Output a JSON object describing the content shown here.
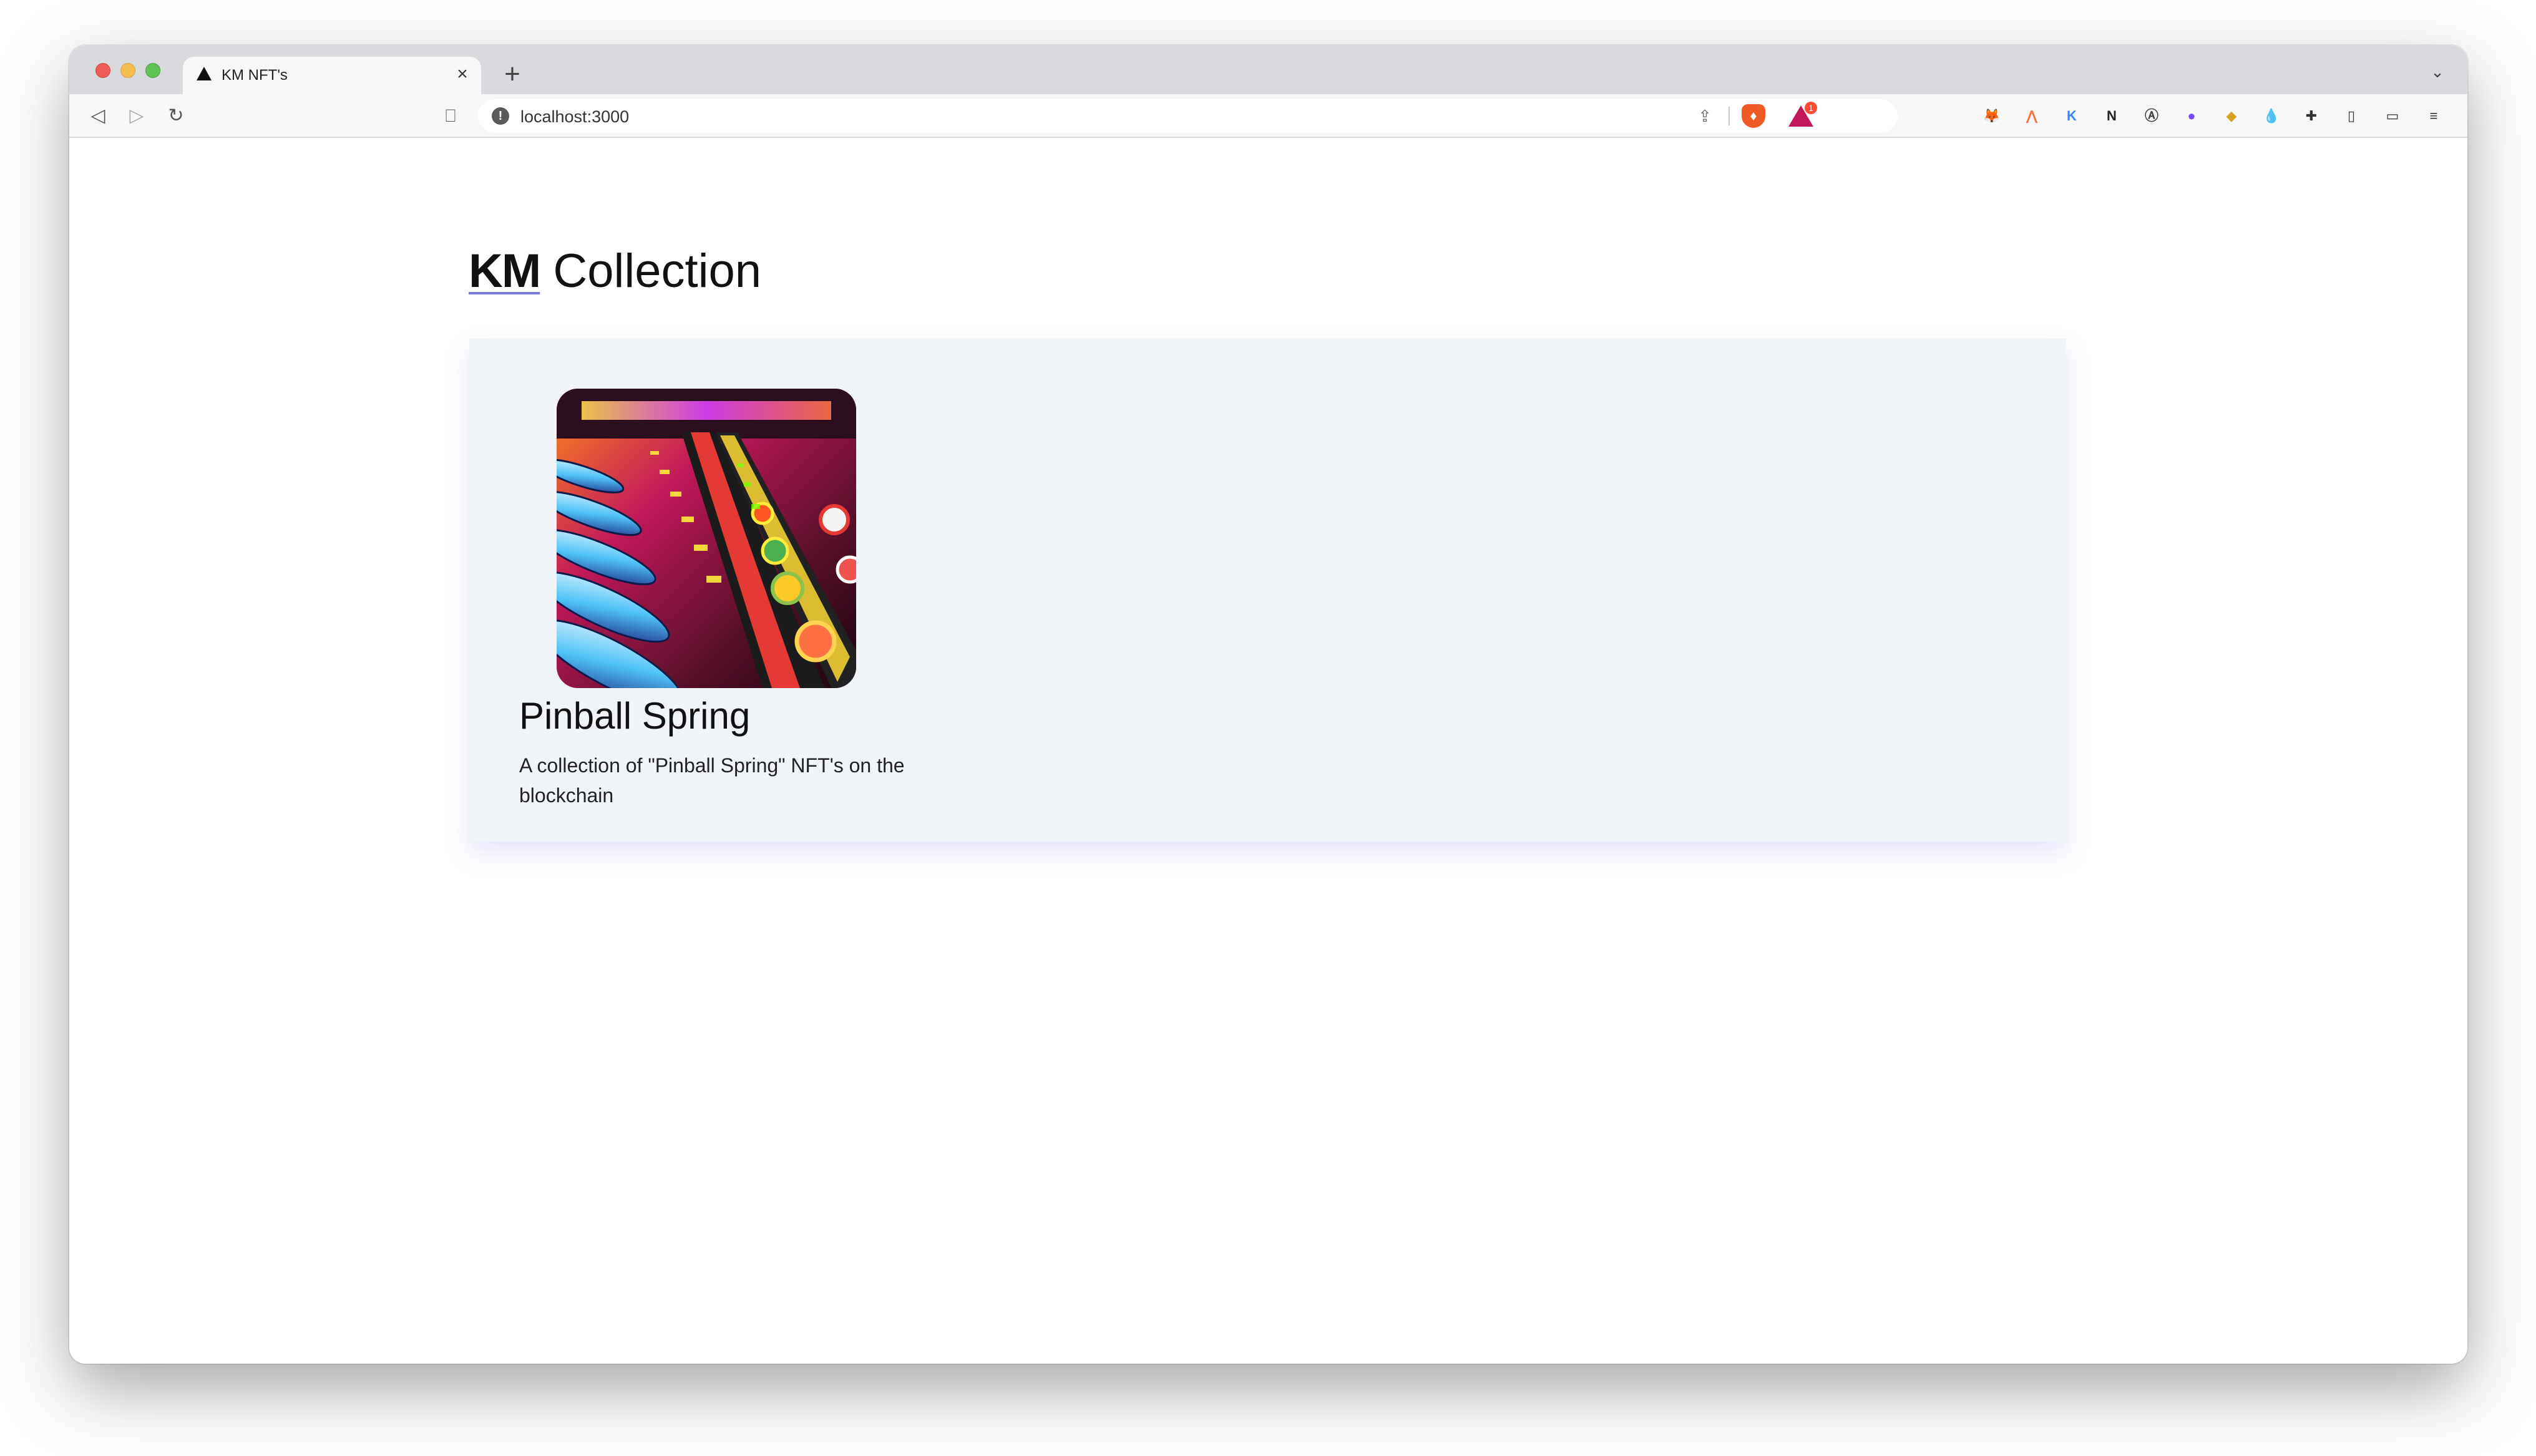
{
  "browser": {
    "tab": {
      "title": "KM NFT's",
      "close_glyph": "×"
    },
    "new_tab_glyph": "+",
    "tab_list_glyph": "⌄",
    "nav": {
      "back_glyph": "◁",
      "forward_glyph": "▷",
      "reload_glyph": "↻",
      "bookmark_glyph": "⎕"
    },
    "address_bar": {
      "url": "localhost:3000",
      "info_glyph": "!",
      "share_glyph": "⇪"
    },
    "brave_shield_glyph": "♦",
    "rewards_badge_count": "1",
    "extensions": [
      {
        "name": "metamask-icon",
        "glyph": "🦊",
        "color": "#f6851b"
      },
      {
        "name": "brave-wallet-ext-icon",
        "glyph": "⋀",
        "color": "#ff7139"
      },
      {
        "name": "k-extension-icon",
        "glyph": "K",
        "color": "#3b82f6"
      },
      {
        "name": "notion-icon",
        "glyph": "N",
        "color": "#222222"
      },
      {
        "name": "a-circle-icon",
        "glyph": "Ⓐ",
        "color": "#444444"
      },
      {
        "name": "purple-circle-icon",
        "glyph": "●",
        "color": "#7c4dff"
      },
      {
        "name": "dark-square-icon",
        "glyph": "◆",
        "color": "#d4a21f"
      },
      {
        "name": "drop-icon",
        "glyph": "💧",
        "color": "#6ab0f3"
      },
      {
        "name": "puzzle-icon",
        "glyph": "✚",
        "color": "#333333"
      },
      {
        "name": "sidebar-toggle-icon",
        "glyph": "▯",
        "color": "#333333"
      },
      {
        "name": "wallet-icon",
        "glyph": "▭",
        "color": "#333333"
      },
      {
        "name": "menu-icon",
        "glyph": "≡",
        "color": "#333333"
      }
    ]
  },
  "page": {
    "title_brand": "KM",
    "title_rest": " Collection",
    "collections": [
      {
        "name": "Pinball Spring",
        "description": "A collection of \"Pinball Spring\" NFT's on the blockchain",
        "image_icon": "pinball-artwork"
      }
    ]
  },
  "colors": {
    "panel_background": "#f0f4f9",
    "tabstrip": "#d8dadd",
    "toolbar": "#f7f7f8",
    "brave_orange": "#f05a24"
  }
}
